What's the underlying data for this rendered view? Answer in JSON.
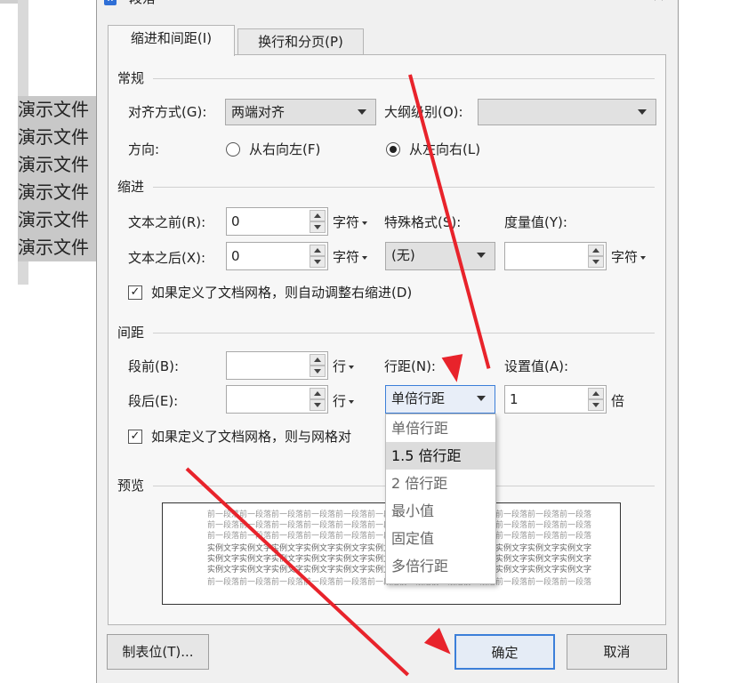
{
  "document": {
    "lines": [
      "演示文件",
      "演示文件",
      "演示文件",
      "演示文件",
      "演示文件",
      "演示文件"
    ]
  },
  "dialog": {
    "title": "段落",
    "close_glyph": "×",
    "app_icon_glyph": "W",
    "tabs": [
      {
        "label": "缩进和间距(I)",
        "active": true
      },
      {
        "label": "换行和分页(P)",
        "active": false
      }
    ],
    "general": {
      "section": "常规",
      "alignment_label": "对齐方式(G):",
      "alignment_value": "两端对齐",
      "outline_label": "大纲级别(O):",
      "outline_value": "",
      "direction_label": "方向:",
      "rtl_label": "从右向左(F)",
      "ltr_label": "从左向右(L)"
    },
    "indent": {
      "section": "缩进",
      "before_label": "文本之前(R):",
      "before_value": "0",
      "before_unit": "字符",
      "after_label": "文本之后(X):",
      "after_value": "0",
      "after_unit": "字符",
      "special_label": "特殊格式(S):",
      "special_value": "(无)",
      "measure_label": "度量值(Y):",
      "measure_value": "",
      "measure_unit": "字符",
      "grid_checkbox": "如果定义了文档网格，则自动调整右缩进(D)",
      "check_glyph": "✓"
    },
    "spacing": {
      "section": "间距",
      "before_label": "段前(B):",
      "before_value": "",
      "before_unit": "行",
      "after_label": "段后(E):",
      "after_value": "",
      "after_unit": "行",
      "line_label": "行距(N):",
      "line_value": "单倍行距",
      "set_label": "设置值(A):",
      "set_value": "1",
      "set_unit": "倍",
      "grid_checkbox": "如果定义了文档网格，则与网格对"
    },
    "line_spacing_options": [
      {
        "label": "单倍行距",
        "highlighted": false
      },
      {
        "label": "1.5 倍行距",
        "highlighted": true
      },
      {
        "label": "2 倍行距",
        "highlighted": false
      },
      {
        "label": "最小值",
        "highlighted": false
      },
      {
        "label": "固定值",
        "highlighted": false
      },
      {
        "label": "多倍行距",
        "highlighted": false
      }
    ],
    "preview": {
      "section": "预览",
      "prev_text": "前一段落前一段落前一段落前一段落前一段落前一段落前一段落前一段落前一段落前一段落前一段落前一段落",
      "sample_text": "实例文字实例文字实例文字实例文字实例文字实例文字实例文字实例文字实例文字实例文字实例文字实例文字"
    },
    "buttons": {
      "tabs_button": "制表位(T)...",
      "ok": "确定",
      "cancel": "取消"
    }
  },
  "colors": {
    "annotation_arrow": "#e8232b",
    "focus_blue": "#3c7fd9"
  }
}
